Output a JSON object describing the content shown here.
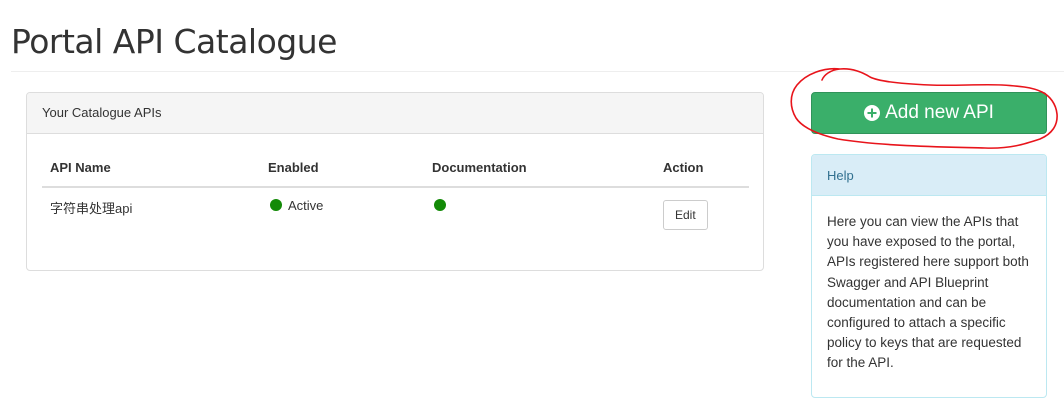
{
  "page": {
    "title": "Portal API Catalogue"
  },
  "catalogue": {
    "heading": "Your Catalogue APIs",
    "columns": [
      "API Name",
      "Enabled",
      "Documentation",
      "Action"
    ],
    "rows": [
      {
        "api_name": "字符串处理api",
        "enabled_status": "Active",
        "enabled_color": "#138a07",
        "documentation_color": "#138a07",
        "action_label": "Edit"
      }
    ]
  },
  "add_api": {
    "label": "Add new API",
    "icon": "plus-circle-icon",
    "color": "#3aaf6a"
  },
  "annotation": {
    "color": "#e8141b",
    "shape": "hand-drawn circle around Add new API button"
  },
  "help": {
    "heading": "Help",
    "text": "Here you can view the APIs that you have exposed to the portal, APIs registered here support both Swagger and API Blueprint documentation and can be configured to attach a specific policy to keys that are requested for the API."
  }
}
